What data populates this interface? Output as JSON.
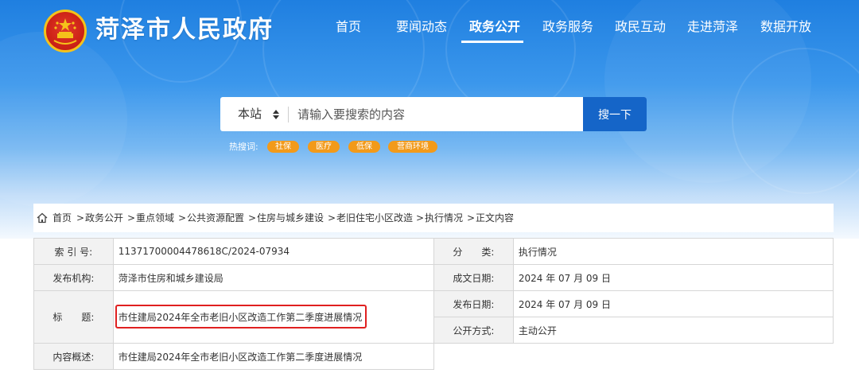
{
  "site": {
    "title": "菏泽市人民政府",
    "logo_icon": "national-emblem-icon"
  },
  "nav": {
    "items": [
      "首页",
      "要闻动态",
      "政务公开",
      "政务服务",
      "政民互动",
      "走进菏泽",
      "数据开放"
    ],
    "active": "政务公开"
  },
  "search": {
    "scope": "本站",
    "placeholder": "请输入要搜索的内容",
    "button": "搜一下",
    "hot_label": "热搜词:",
    "hot_words": [
      "社保",
      "医疗",
      "低保",
      "营商环境"
    ]
  },
  "breadcrumb": {
    "home_icon": "home-icon",
    "items": [
      "首页",
      "政务公开",
      "重点领域",
      "公共资源配置",
      "住房与城乡建设",
      "老旧住宅小区改造",
      "执行情况",
      "正文内容"
    ],
    "separator": ">"
  },
  "meta": {
    "index_label": "索 引 号:",
    "index_value": "11371700004478618C/2024-07934",
    "category_label": "分　　类:",
    "category_value": "执行情况",
    "publisher_label": "发布机构:",
    "publisher_value": "菏泽市住房和城乡建设局",
    "created_label": "成文日期:",
    "created_value": "2024 年 07 月 09 日",
    "title_label": "标　　题:",
    "title_value": "市住建局2024年全市老旧小区改造工作第二季度进展情况",
    "published_label": "发布日期:",
    "published_value": "2024 年 07 月 09 日",
    "open_label": "公开方式:",
    "open_value": "主动公开",
    "summary_label": "内容概述:",
    "summary_value": "市住建局2024年全市老旧小区改造工作第二季度进展情况"
  },
  "colors": {
    "primary": "#1565c8",
    "hot_tag": "#f29a1a",
    "highlight": "#e02020"
  }
}
